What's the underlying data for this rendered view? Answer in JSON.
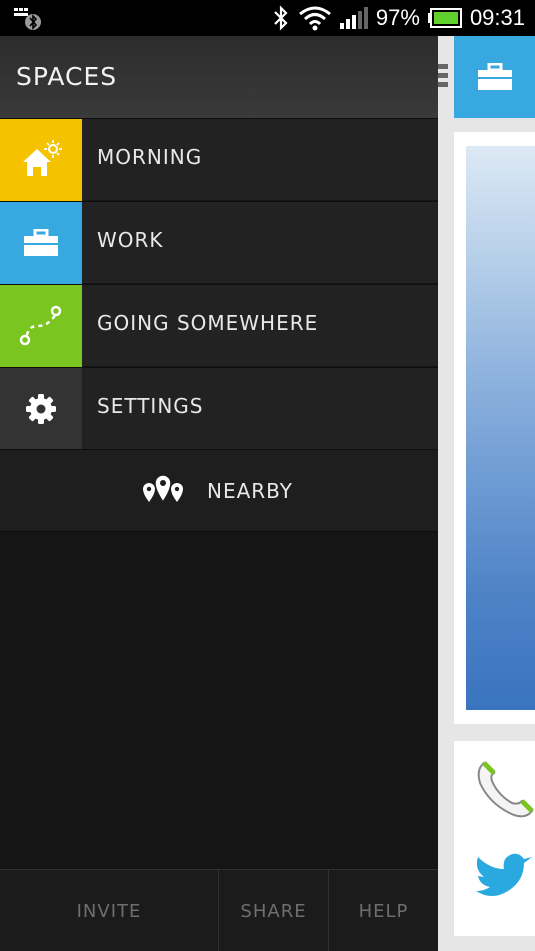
{
  "status": {
    "battery": "97%",
    "time": "09:31",
    "icons": [
      "bluetooth-notification-icon",
      "bluetooth-icon",
      "wifi-icon",
      "signal-icon",
      "battery-icon"
    ]
  },
  "drawer": {
    "title": "SPACES",
    "items": [
      {
        "label": "MORNING",
        "icon": "home-sun-icon",
        "color": "#f5c200"
      },
      {
        "label": "WORK",
        "icon": "briefcase-icon",
        "color": "#38a8e0"
      },
      {
        "label": "GOING SOMEWHERE",
        "icon": "route-icon",
        "color": "#7ac520"
      },
      {
        "label": "SETTINGS",
        "icon": "gear-icon",
        "color": "#333333"
      }
    ],
    "nearby": {
      "label": "NEARBY",
      "icon": "map-pins-icon"
    },
    "footer": {
      "invite": "INVITE",
      "share": "SHARE",
      "help": "HELP"
    }
  },
  "main": {
    "header_icon": "briefcase-icon",
    "cards": [
      "landscape-image",
      "phone-icon",
      "twitter-icon"
    ]
  }
}
